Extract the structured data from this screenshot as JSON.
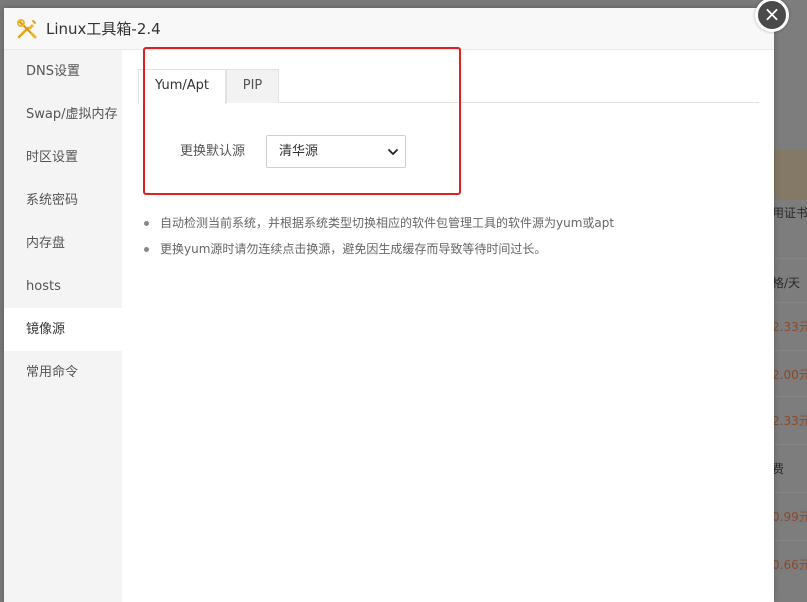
{
  "window": {
    "title": "Linux工具箱-2.4",
    "close_label": "×",
    "title_icon": "tools-icon"
  },
  "sidebar": {
    "items": [
      {
        "label": "DNS设置"
      },
      {
        "label": "Swap/虚拟内存"
      },
      {
        "label": "时区设置"
      },
      {
        "label": "系统密码"
      },
      {
        "label": "内存盘"
      },
      {
        "label": "hosts"
      },
      {
        "label": "镜像源",
        "active": true
      },
      {
        "label": "常用命令"
      }
    ]
  },
  "tabs": [
    {
      "label": "Yum/Apt",
      "active": true
    },
    {
      "label": "PIP",
      "active": false
    }
  ],
  "form": {
    "label": "更换默认源",
    "select_value": "清华源"
  },
  "notes": [
    "自动检测当前系统，并根据系统类型切换相应的软件包管理工具的软件源为yum或apt",
    "更换yum源时请勿连续点击换源，避免因生成缓存而导致等待时间过长。"
  ],
  "background": {
    "label_fragment": "用证书",
    "header_fragment": "格/天",
    "cells": [
      "2.33元",
      "2.00元",
      "2.33元",
      "费",
      "0.99元",
      "0.66元"
    ]
  },
  "colors": {
    "highlight": "#e02020",
    "price": "#8a4a2a"
  }
}
